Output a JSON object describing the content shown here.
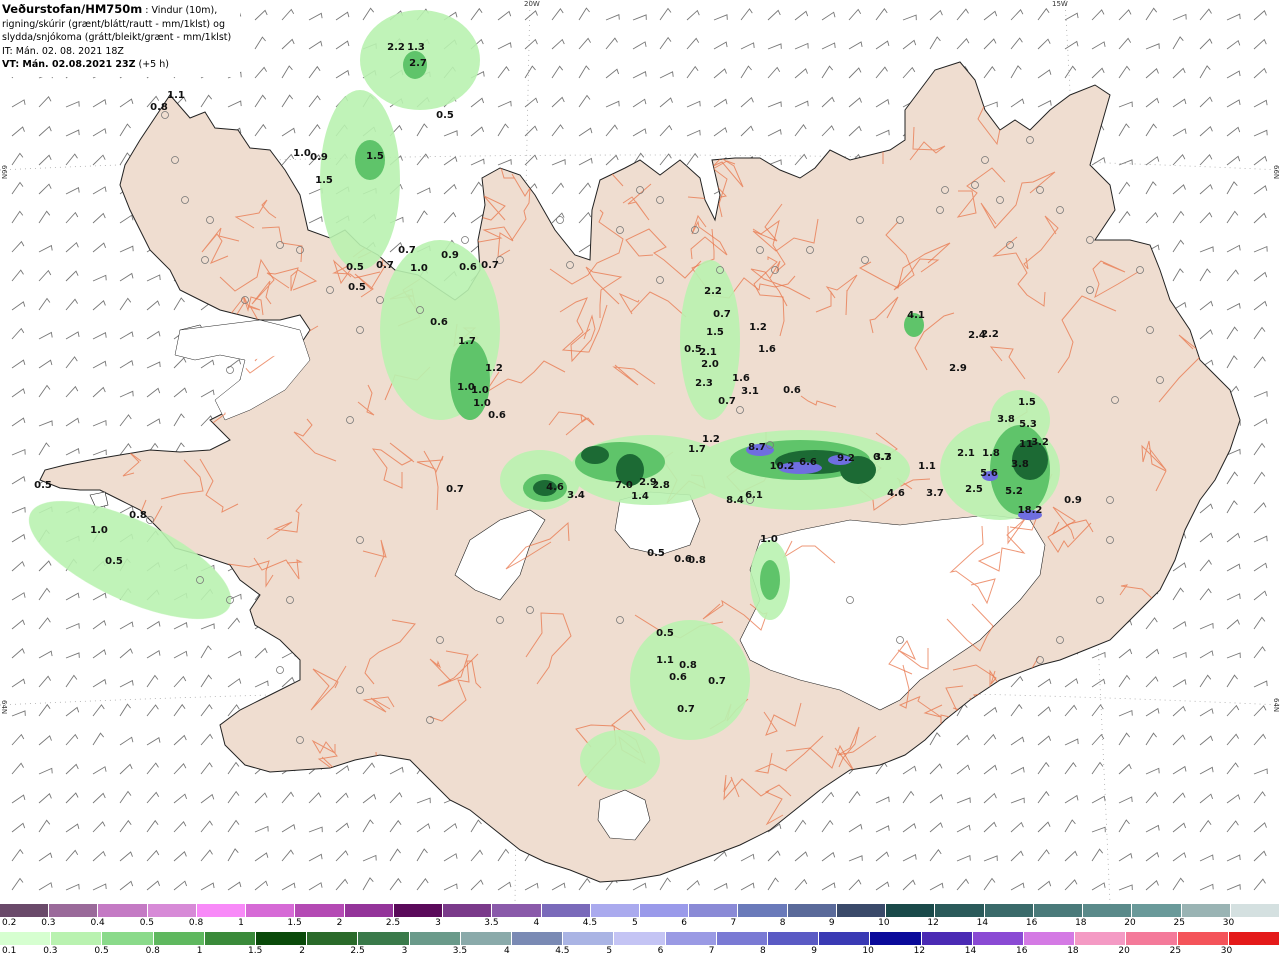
{
  "header": {
    "title": "Veðurstofan/HM750m",
    "title_suffix": " : Vindur (10m),",
    "line2": "rigning/skúrir (grænt/blátt/rautt - mm/1klst) og",
    "line3": "slydda/snjókoma (grátt/bleikt/grænt - mm/1klst)",
    "it_label": "IT: Mán. 02. 08. 2021 18Z",
    "vt_label": "VT: Mán. 02.08.2021 23Z",
    "vt_suffix": " (+5 h)"
  },
  "grid_labels": {
    "top_20w": "20W",
    "top_15w": "15W",
    "left_66n": "66N",
    "right_66n": "66N",
    "left_64n": "64N",
    "right_64n": "64N"
  },
  "colors": {
    "land": "#efddd0",
    "road": "#e8744a",
    "glacier": "#ffffff",
    "sea": "#ffffff",
    "precip_light": "#b9f2b0",
    "precip_mid": "#5fc46a",
    "precip_dark": "#1c6a34",
    "precip_blue": "#6f6ee0"
  },
  "precip_values": [
    {
      "v": "0.8"
    },
    {
      "v": "1.1"
    },
    {
      "v": "2.2"
    },
    {
      "v": "1.3"
    },
    {
      "v": "2.7"
    },
    {
      "v": "0.5"
    },
    {
      "v": "1.0"
    },
    {
      "v": "0.9"
    },
    {
      "v": "1.5"
    },
    {
      "v": "1.5"
    },
    {
      "v": "0.7"
    },
    {
      "v": "1.0"
    },
    {
      "v": "0.9"
    },
    {
      "v": "0.6"
    },
    {
      "v": "0.7"
    },
    {
      "v": "0.5"
    },
    {
      "v": "0.7"
    },
    {
      "v": "0.5"
    },
    {
      "v": "0.6"
    },
    {
      "v": "1.7"
    },
    {
      "v": "1.2"
    },
    {
      "v": "1.0"
    },
    {
      "v": "1.0"
    },
    {
      "v": "1.0"
    },
    {
      "v": "0.6"
    },
    {
      "v": "2.2"
    },
    {
      "v": "0.7"
    },
    {
      "v": "1.5"
    },
    {
      "v": "0.5"
    },
    {
      "v": "2.1"
    },
    {
      "v": "2.0"
    },
    {
      "v": "1.2"
    },
    {
      "v": "1.6"
    },
    {
      "v": "2.3"
    },
    {
      "v": "1.6"
    },
    {
      "v": "3.1"
    },
    {
      "v": "0.7"
    },
    {
      "v": "0.6"
    },
    {
      "v": "1.2"
    },
    {
      "v": "1.7"
    },
    {
      "v": "4.1"
    },
    {
      "v": "2.4"
    },
    {
      "v": "2.2"
    },
    {
      "v": "2.9"
    },
    {
      "v": "1.5"
    },
    {
      "v": "3.8"
    },
    {
      "v": "5.3"
    },
    {
      "v": "3.3"
    },
    {
      "v": "0.7"
    },
    {
      "v": "4.6"
    },
    {
      "v": "3.4"
    },
    {
      "v": "7.0"
    },
    {
      "v": "2.9"
    },
    {
      "v": "2.8"
    },
    {
      "v": "1.4"
    },
    {
      "v": "8.7"
    },
    {
      "v": "10.2"
    },
    {
      "v": "6.6"
    },
    {
      "v": "9.2"
    },
    {
      "v": "0.7"
    },
    {
      "v": "1.1"
    },
    {
      "v": "2.1"
    },
    {
      "v": "1.8"
    },
    {
      "v": "11"
    },
    {
      "v": "3.2"
    },
    {
      "v": "3.8"
    },
    {
      "v": "5.6"
    },
    {
      "v": "5.2"
    },
    {
      "v": "2.5"
    },
    {
      "v": "3.7"
    },
    {
      "v": "4.6"
    },
    {
      "v": "8.4"
    },
    {
      "v": "6.1"
    },
    {
      "v": "18.2"
    },
    {
      "v": "0.9"
    },
    {
      "v": "0.5"
    },
    {
      "v": "0.8"
    },
    {
      "v": "1.0"
    },
    {
      "v": "0.5"
    },
    {
      "v": "1.0"
    },
    {
      "v": "0.5"
    },
    {
      "v": "0.6"
    },
    {
      "v": "0.8"
    },
    {
      "v": "0.5"
    },
    {
      "v": "1.1"
    },
    {
      "v": "0.8"
    },
    {
      "v": "0.6"
    },
    {
      "v": "0.7"
    },
    {
      "v": "0.7"
    },
    {
      "v": "0.5"
    }
  ],
  "legend_snow": {
    "labels": [
      "0.2",
      "0.3",
      "0.4",
      "0.5",
      "0.8",
      "1",
      "1.5",
      "2",
      "2.5",
      "3",
      "3.5",
      "4",
      "4.5",
      "5",
      "6",
      "7",
      "8",
      "9",
      "10",
      "12",
      "14",
      "16",
      "18",
      "20",
      "25",
      "30"
    ],
    "colors": [
      "#6a4a6a",
      "#9a6a9a",
      "#c47ac4",
      "#d78ad7",
      "#f88af8",
      "#d66ad6",
      "#b44ab4",
      "#94349a",
      "#5a0a5a",
      "#7a3a8a",
      "#8a5aaa",
      "#7a6aba",
      "#aaaaee",
      "#9a9aea",
      "#8a8ad6",
      "#6a7aba",
      "#5a6a9a",
      "#3a4a6a",
      "#1a4a4a",
      "#2a5a5a",
      "#3a6a6a",
      "#4a7a7a",
      "#5a8a8a",
      "#6a9a9a",
      "#9ab4b4",
      "#d4e0e0"
    ]
  },
  "legend_rain": {
    "labels": [
      "0.1",
      "0.3",
      "0.5",
      "0.8",
      "1",
      "1.5",
      "2",
      "2.5",
      "3",
      "3.5",
      "4",
      "4.5",
      "5",
      "6",
      "7",
      "8",
      "9",
      "10",
      "12",
      "14",
      "16",
      "18",
      "20",
      "25",
      "30"
    ],
    "colors": [
      "#d6ffd0",
      "#b9f2b0",
      "#8ada8a",
      "#5fb85f",
      "#3a8a3a",
      "#0a4a0a",
      "#2a6a2a",
      "#3a7a4a",
      "#6a9a8a",
      "#8aaaaa",
      "#7a8ab4",
      "#aab4e4",
      "#c4c4f4",
      "#9a9ae4",
      "#7a7ad4",
      "#5a5ac4",
      "#3a3ab4",
      "#0a0a9a",
      "#4a2ab4",
      "#8a4ad4",
      "#d47ae4",
      "#f49ac4",
      "#f47a9a",
      "#f4545a",
      "#e41a1a"
    ]
  }
}
